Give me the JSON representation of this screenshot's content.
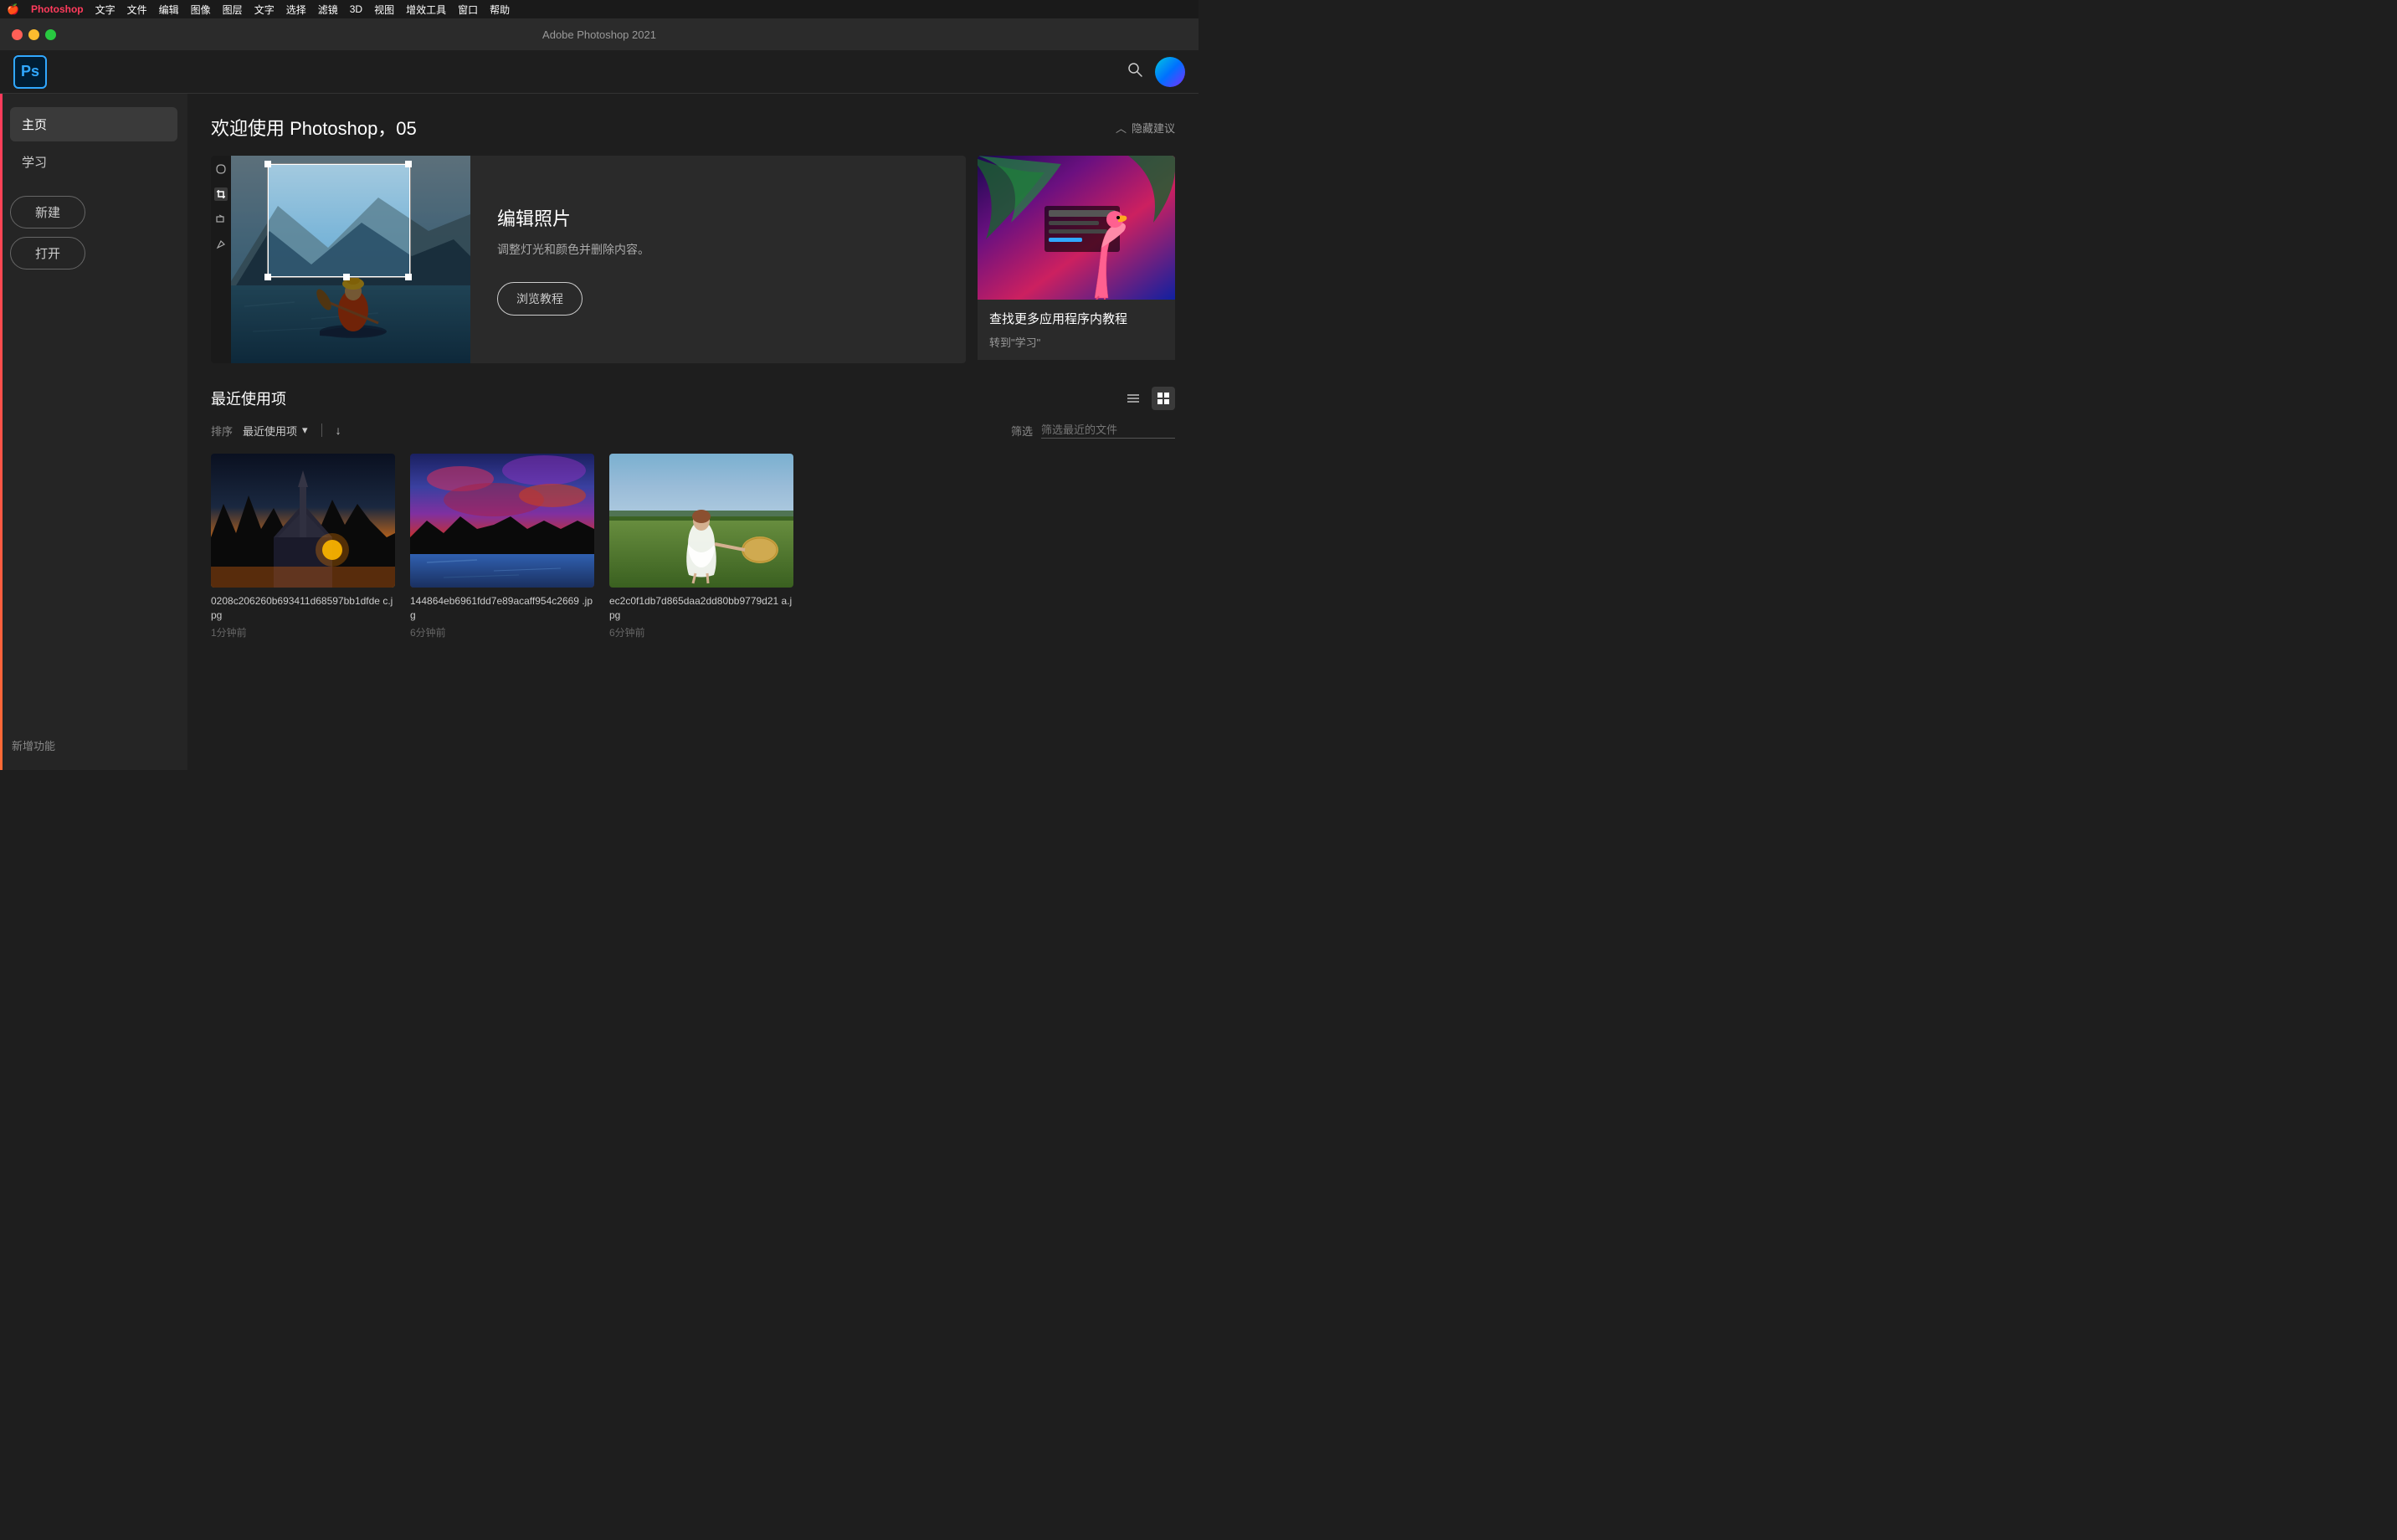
{
  "menubar": {
    "apple": "🍎",
    "app_name": "Photoshop",
    "items": [
      "文字",
      "图像",
      "图层",
      "文字",
      "选择",
      "滤镜",
      "3D",
      "视图",
      "增效工具",
      "窗口",
      "帮助"
    ],
    "menu_items_full": [
      "文字",
      "文件",
      "编辑",
      "图像",
      "图层",
      "文字",
      "选择",
      "滤镜",
      "3D",
      "视图",
      "增效工具",
      "窗口",
      "帮助"
    ]
  },
  "titlebar": {
    "title": "Adobe Photoshop 2021"
  },
  "header": {
    "ps_logo": "Ps",
    "search_label": "搜索"
  },
  "sidebar": {
    "home_label": "主页",
    "learn_label": "学习",
    "new_button": "新建",
    "open_button": "打开",
    "new_features_label": "新增功能"
  },
  "welcome": {
    "title": "欢迎使用 Photoshop，05",
    "hide_label": "隐藏建议"
  },
  "tutorial_card": {
    "title": "编辑照片",
    "description": "调整灯光和颜色并删除内容。",
    "button_label": "浏览教程"
  },
  "side_card": {
    "title": "查找更多应用程序内教程",
    "link_label": "转到\"学习\""
  },
  "recent": {
    "title": "最近使用项",
    "sort_label": "排序",
    "sort_value": "最近使用项",
    "filter_label": "筛选",
    "filter_placeholder": "筛选最近的文件"
  },
  "files": [
    {
      "name": "0208c206260b693411d68597bb1dfde c.jpg",
      "time": "1分钟前",
      "thumb_type": "temple"
    },
    {
      "name": "144864eb6961fdd7e89acaff954c2669 .jpg",
      "time": "6分钟前",
      "thumb_type": "sunset"
    },
    {
      "name": "ec2c0f1db7d865daa2dd80bb9779d21 a.jpg",
      "time": "6分钟前",
      "thumb_type": "woman"
    }
  ],
  "icons": {
    "search": "🔍",
    "chevron_up": "︿",
    "list_view": "☰",
    "grid_view": "⊞",
    "dropdown_arrow": "▾",
    "sort_down": "↓"
  }
}
